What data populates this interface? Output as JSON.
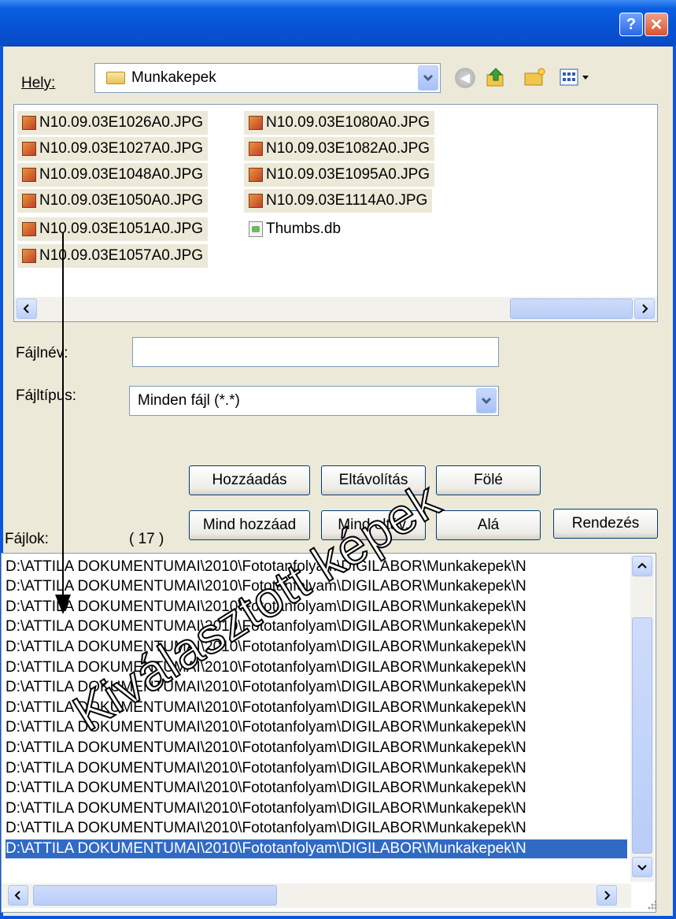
{
  "titlebar": {
    "help_label": "?",
    "close_label": "✕"
  },
  "location": {
    "label": "Hely:",
    "value": "Munkakepek"
  },
  "files": [
    "N10.09.03E1026A0.JPG",
    "N10.09.03E1027A0.JPG",
    "N10.09.03E1048A0.JPG",
    "N10.09.03E1050A0.JPG",
    "N10.09.03E1051A0.JPG",
    "N10.09.03E1057A0.JPG",
    "N10.09.03E1080A0.JPG",
    "N10.09.03E1082A0.JPG",
    "N10.09.03E1095A0.JPG",
    "N10.09.03E1114A0.JPG",
    "Thumbs.db"
  ],
  "filename": {
    "label": "Fájlnév:",
    "value": ""
  },
  "filetype": {
    "label": "Fájltípus:",
    "value": "Minden fájl (*.*)"
  },
  "buttons": {
    "add": "Hozzáadás",
    "remove": "Eltávolítás",
    "up": "Fölé",
    "add_all": "Mind hozzáad",
    "remove_all": "Mind eltáv.",
    "down": "Alá",
    "sort": "Rendezés"
  },
  "selected": {
    "label": "Fájlok:",
    "count": "( 17 )"
  },
  "paths": [
    "D:\\ATTILA DOKUMENTUMAI\\2010\\Fototanfolyam\\DIGILABOR\\Munkakepek\\N",
    "D:\\ATTILA DOKUMENTUMAI\\2010\\Fototanfolyam\\DIGILABOR\\Munkakepek\\N",
    "D:\\ATTILA DOKUMENTUMAI\\2010\\Fototanfolyam\\DIGILABOR\\Munkakepek\\N",
    "D:\\ATTILA DOKUMENTUMAI\\2010\\Fototanfolyam\\DIGILABOR\\Munkakepek\\N",
    "D:\\ATTILA DOKUMENTUMAI\\2010\\Fototanfolyam\\DIGILABOR\\Munkakepek\\N",
    "D:\\ATTILA DOKUMENTUMAI\\2010\\Fototanfolyam\\DIGILABOR\\Munkakepek\\N",
    "D:\\ATTILA DOKUMENTUMAI\\2010\\Fototanfolyam\\DIGILABOR\\Munkakepek\\N",
    "D:\\ATTILA DOKUMENTUMAI\\2010\\Fototanfolyam\\DIGILABOR\\Munkakepek\\N",
    "D:\\ATTILA DOKUMENTUMAI\\2010\\Fototanfolyam\\DIGILABOR\\Munkakepek\\N",
    "D:\\ATTILA DOKUMENTUMAI\\2010\\Fototanfolyam\\DIGILABOR\\Munkakepek\\N",
    "D:\\ATTILA DOKUMENTUMAI\\2010\\Fototanfolyam\\DIGILABOR\\Munkakepek\\N",
    "D:\\ATTILA DOKUMENTUMAI\\2010\\Fototanfolyam\\DIGILABOR\\Munkakepek\\N",
    "D:\\ATTILA DOKUMENTUMAI\\2010\\Fototanfolyam\\DIGILABOR\\Munkakepek\\N",
    "D:\\ATTILA DOKUMENTUMAI\\2010\\Fototanfolyam\\DIGILABOR\\Munkakepek\\N",
    "D:\\ATTILA DOKUMENTUMAI\\2010\\Fototanfolyam\\DIGILABOR\\Munkakepek\\N"
  ],
  "annotation": "Kiválasztott képek",
  "colors": {
    "titlebar": "#0753d6",
    "selection": "#316ac5",
    "dialog_bg": "#ece9d8"
  }
}
